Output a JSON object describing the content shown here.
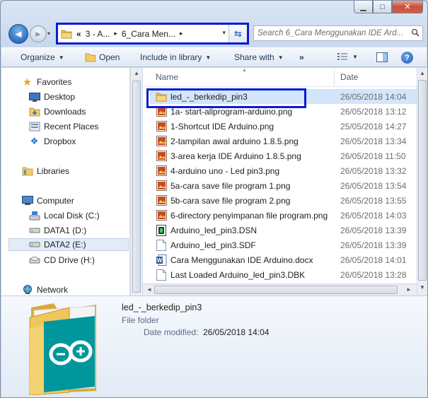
{
  "window": {
    "minimize": "▁",
    "maximize": "□",
    "close": "✕"
  },
  "nav": {
    "back": "◄",
    "forward": "►",
    "recent": "▾"
  },
  "address": {
    "overflow": "«",
    "crumbs": [
      "3 - A...",
      "6_Cara Men..."
    ],
    "sep": "▸",
    "dropdown": "▾",
    "refresh": "⇆"
  },
  "search": {
    "placeholder": "Search 6_Cara Menggunakan IDE Ard...",
    "icon": "search-icon"
  },
  "toolbar": {
    "organize": "Organize",
    "open": "Open",
    "include": "Include in library",
    "share": "Share with",
    "more": "»",
    "help": "?"
  },
  "sidebar": {
    "favorites": "Favorites",
    "desktop": "Desktop",
    "downloads": "Downloads",
    "recent_places": "Recent Places",
    "dropbox": "Dropbox",
    "libraries": "Libraries",
    "computer": "Computer",
    "local_disk": "Local Disk (C:)",
    "data1": "DATA1 (D:)",
    "data2": "DATA2 (E:)",
    "cd_drive": "CD Drive (H:)",
    "network": "Network"
  },
  "columns": {
    "name": "Name",
    "date": "Date"
  },
  "files": [
    {
      "name": "led_-_berkedip_pin3",
      "date": "26/05/2018 14:04",
      "type": "folder"
    },
    {
      "name": "1a- start-allprogram-arduino.png",
      "date": "26/05/2018 13:12",
      "type": "png"
    },
    {
      "name": "1-Shortcut IDE Arduino.png",
      "date": "25/05/2018 14:27",
      "type": "png"
    },
    {
      "name": "2-tampilan awal arduino 1.8.5.png",
      "date": "26/05/2018 13:34",
      "type": "png"
    },
    {
      "name": "3-area kerja IDE Arduino 1.8.5.png",
      "date": "26/05/2018 11:50",
      "type": "png"
    },
    {
      "name": "4-arduino uno - Led pin3.png",
      "date": "26/05/2018 13:32",
      "type": "png"
    },
    {
      "name": "5a-cara save file program 1.png",
      "date": "26/05/2018 13:54",
      "type": "png"
    },
    {
      "name": "5b-cara save file program 2.png",
      "date": "26/05/2018 13:55",
      "type": "png"
    },
    {
      "name": "6-directory penyimpanan file program.png",
      "date": "26/05/2018 14:03",
      "type": "png"
    },
    {
      "name": "Arduino_led_pin3.DSN",
      "date": "26/05/2018 13:39",
      "type": "dsn"
    },
    {
      "name": "Arduino_led_pin3.SDF",
      "date": "26/05/2018 13:39",
      "type": "sdf"
    },
    {
      "name": "Cara Menggunakan IDE Arduino.docx",
      "date": "26/05/2018 14:01",
      "type": "docx"
    },
    {
      "name": "Last Loaded Arduino_led_pin3.DBK",
      "date": "26/05/2018 13:28",
      "type": "dbk"
    }
  ],
  "details": {
    "name": "led_-_berkedip_pin3",
    "type": "File folder",
    "modified_label": "Date modified:",
    "modified_value": "26/05/2018 14:04"
  },
  "colors": {
    "highlight_box": "#0b1bd6",
    "selection": "#d3e5fa",
    "arduino_teal": "#00979c"
  }
}
